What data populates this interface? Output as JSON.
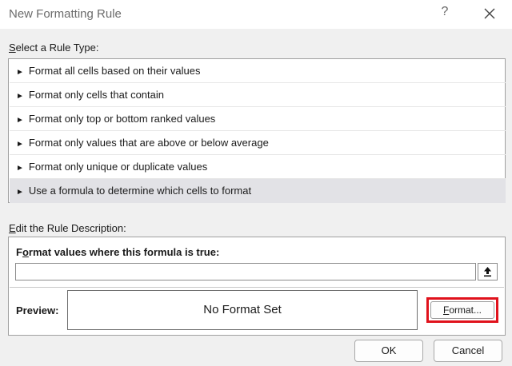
{
  "dialog": {
    "title": "New Formatting Rule",
    "help_icon": "?",
    "close_icon": "close-icon"
  },
  "rule_type": {
    "label_mnemonic": "S",
    "label_rest": "elect a Rule Type:",
    "items": [
      {
        "label": "Format all cells based on their values",
        "selected": false
      },
      {
        "label": "Format only cells that contain",
        "selected": false
      },
      {
        "label": "Format only top or bottom ranked values",
        "selected": false
      },
      {
        "label": "Format only values that are above or below average",
        "selected": false
      },
      {
        "label": "Format only unique or duplicate values",
        "selected": false
      },
      {
        "label": "Use a formula to determine which cells to format",
        "selected": true
      }
    ],
    "arrow_glyph": "►"
  },
  "rule_description": {
    "label_mnemonic": "E",
    "label_rest": "dit the Rule Description:",
    "formula_label_a": "F",
    "formula_label_mnemonic": "o",
    "formula_label_rest": "rmat values where this formula is true:",
    "formula_value": "",
    "preview_label": "Preview:",
    "preview_text": "No Format Set",
    "format_button_mnemonic": "F",
    "format_button_rest": "ormat..."
  },
  "buttons": {
    "ok": "OK",
    "cancel": "Cancel"
  },
  "colors": {
    "highlight_border": "#e0121c",
    "selected_row": "#e2e2e6"
  }
}
